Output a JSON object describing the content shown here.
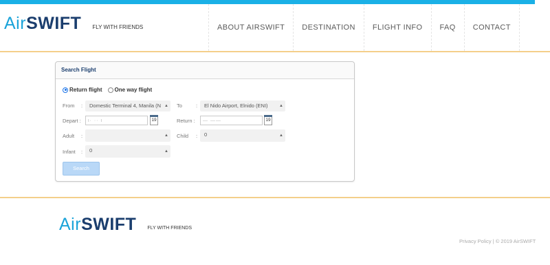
{
  "header": {
    "brand_air": "Air",
    "brand_swift": "SWIFT",
    "tagline": "FLY WITH FRIENDS",
    "accent_color": "#1ab0e6",
    "divider_color": "#f4cf8a"
  },
  "nav": {
    "items": [
      "ABOUT AIRSWIFT",
      "DESTINATION",
      "FLIGHT INFO",
      "FAQ",
      "CONTACT"
    ]
  },
  "search": {
    "title": "Search Flight",
    "trip_return": "Return flight",
    "trip_oneway": "One way flight",
    "selected_trip": "return",
    "from_label": "From",
    "from_value": "Domestic Terminal 4, Manila (N",
    "to_label": "To",
    "to_value": "El Nido Airport, Elnido (ENI)",
    "depart_label": "Depart :",
    "depart_value": "ι· ·· ι",
    "return_label": "Return :",
    "return_value": "— ——",
    "calendar_icon_text": "19",
    "adult_label": "Adult",
    "adult_value": "",
    "child_label": "Child",
    "child_value": "0",
    "infant_label": "Infant",
    "infant_value": "0",
    "search_button": "Search",
    "colon": ":"
  },
  "footer": {
    "brand_air": "Air",
    "brand_swift": "SWIFT",
    "tagline": "FLY WITH FRIENDS",
    "privacy": "Privacy Policy",
    "separator": " | ",
    "copyright": "© 2019 AirSWIFT"
  }
}
